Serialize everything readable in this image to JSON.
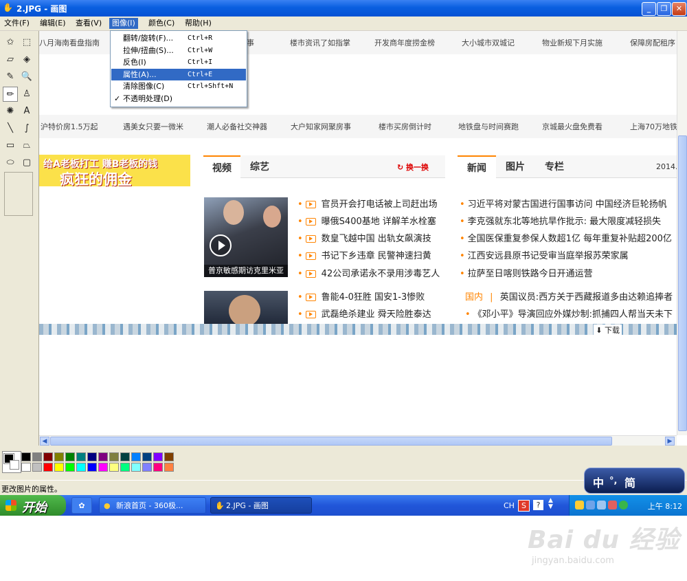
{
  "window": {
    "title": "2.JPG - 画图"
  },
  "menubar": [
    {
      "label": "文件(F)"
    },
    {
      "label": "编辑(E)"
    },
    {
      "label": "查看(V)"
    },
    {
      "label": "图像(I)"
    },
    {
      "label": "颜色(C)"
    },
    {
      "label": "帮助(H)"
    }
  ],
  "image_menu": [
    {
      "label": "翻转/旋转(F)...",
      "shortcut": "Ctrl+R"
    },
    {
      "label": "拉伸/扭曲(S)...",
      "shortcut": "Ctrl+W"
    },
    {
      "label": "反色(I)",
      "shortcut": "Ctrl+I"
    },
    {
      "label": "属性(A)...",
      "shortcut": "Ctrl+E"
    },
    {
      "label": "清除图像(C)",
      "shortcut": "Ctrl+Shft+N"
    },
    {
      "label": "不透明处理(D)",
      "shortcut": "",
      "checked": "✓"
    }
  ],
  "tools": [
    {
      "name": "free-select-icon",
      "glyph": "✩"
    },
    {
      "name": "select-icon",
      "glyph": "⬚"
    },
    {
      "name": "eraser-icon",
      "glyph": "▱"
    },
    {
      "name": "fill-icon",
      "glyph": "◈"
    },
    {
      "name": "color-picker-icon",
      "glyph": "✎"
    },
    {
      "name": "magnifier-icon",
      "glyph": "🔍"
    },
    {
      "name": "pencil-icon",
      "glyph": "✏"
    },
    {
      "name": "brush-icon",
      "glyph": "♙"
    },
    {
      "name": "airbrush-icon",
      "glyph": "✺"
    },
    {
      "name": "text-icon",
      "glyph": "A"
    },
    {
      "name": "line-icon",
      "glyph": "╲"
    },
    {
      "name": "curve-icon",
      "glyph": "∫"
    },
    {
      "name": "rectangle-icon",
      "glyph": "▭"
    },
    {
      "name": "polygon-icon",
      "glyph": "⏢"
    },
    {
      "name": "ellipse-icon",
      "glyph": "⬭"
    },
    {
      "name": "rounded-rect-icon",
      "glyph": "▢"
    }
  ],
  "canvas": {
    "ticker1": [
      "八月海南看盘指南",
      "西三事",
      "楼市资讯了如指掌",
      "开发商年度捞金榜",
      "大小城市双城记",
      "物业新规下月实施",
      "保障房配租序"
    ],
    "ticker2": [
      "沪特价房1.5万起",
      "遇美女只要一微米",
      "潮人必备社交神器",
      "大户知家网聚房事",
      "楼市买房倒计时",
      "地铁盘与时间赛跑",
      "京城最火盘免费看",
      "上海70万地铁"
    ],
    "promo": {
      "line1": "给A老板打工 赚B老板的钱",
      "line2": "疯狂的佣金"
    },
    "video_tabs": {
      "tab1": "视频",
      "tab2": "综艺",
      "refresh": "换一换"
    },
    "news_tabs": {
      "tab1": "新闻",
      "tab2": "图片",
      "tab3": "专栏",
      "date": "2014."
    },
    "photo1_caption": "普京敏感期访克里米亚",
    "video_news": [
      "官员开会打电话被上司赶出场",
      "曝俄S400基地 详解羊水栓塞",
      "数皇飞越中国 出轨女飙演技",
      "书记下乡违章 民警神速扫黄",
      "42公司承诺永不录用涉毒艺人",
      "鲁能4-0狂胜 国安1-3惨败",
      "武磊绝杀建业 舜天险胜泰达"
    ],
    "right_news": [
      "习近平将对蒙古国进行国事访问 中国经济巨轮扬帆",
      "李克强就东北等地抗旱作批示: 最大限度减轻损失",
      "全国医保重复参保人数超1亿 每年重复补贴超200亿",
      "江西安远县原书记受审当庭举报苏荣家属",
      "拉萨至日喀则铁路今日开通运营"
    ],
    "right_news2": [
      {
        "tag": "国内",
        "sep": "|",
        "text": "英国议员:西方关于西藏报道多由达赖追捧者"
      },
      {
        "tag": "",
        "sep": "",
        "text": "《邓小平》导演回应外媒炒制:抓捕四人帮当天未下"
      }
    ],
    "download_label": "下载"
  },
  "palette": {
    "row1": [
      "#000000",
      "#808080",
      "#800000",
      "#808000",
      "#008000",
      "#008080",
      "#000080",
      "#800080",
      "#808040",
      "#004040",
      "#0080ff",
      "#004080",
      "#8000ff",
      "#804000"
    ],
    "row2": [
      "#ffffff",
      "#c0c0c0",
      "#ff0000",
      "#ffff00",
      "#00ff00",
      "#00ffff",
      "#0000ff",
      "#ff00ff",
      "#ffff80",
      "#00ff80",
      "#80ffff",
      "#8080ff",
      "#ff0080",
      "#ff8040"
    ]
  },
  "statusbar": {
    "text": "更改图片的属性。"
  },
  "ime": {
    "c1": "中",
    "c2": "°,",
    "c3": "简"
  },
  "taskbar": {
    "start": "开始",
    "btn1": "新浪首页 - 360极...",
    "btn2": "2.JPG - 画图",
    "lang": "CH",
    "clock": "上午 8:12"
  },
  "watermark": {
    "big": "Bai du 经验",
    "small": "jingyan.baidu.com"
  }
}
